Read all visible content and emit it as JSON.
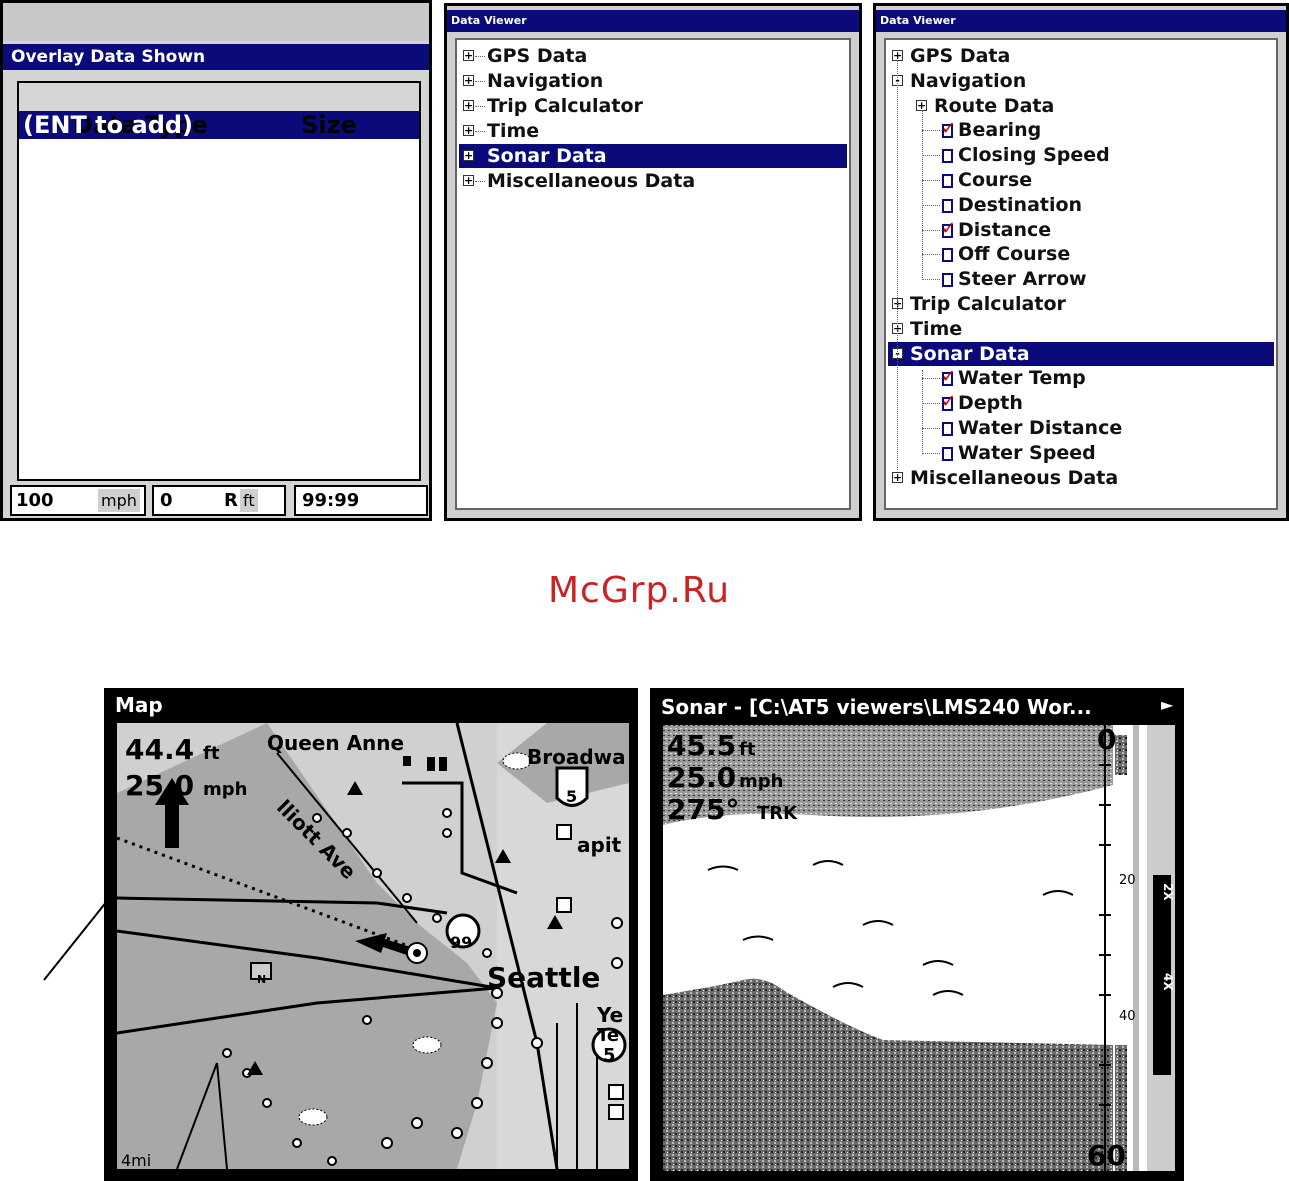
{
  "overlay_panel": {
    "title": "Overlay Data Shown",
    "col_type": "Data Type",
    "col_size": "Size",
    "row": "(ENT to add)",
    "status": {
      "speed": "100",
      "speed_unit": "mph",
      "depth": "0",
      "depth_flag": "R",
      "depth_unit": "ft",
      "time": "99:99"
    }
  },
  "viewer1": {
    "title": "Data Viewer",
    "items": [
      "GPS Data",
      "Navigation",
      "Trip Calculator",
      "Time",
      "Sonar Data",
      "Miscellaneous Data"
    ],
    "selected": "Sonar Data"
  },
  "viewer2": {
    "title": "Data Viewer",
    "items": [
      {
        "label": "GPS Data",
        "level": 0,
        "expander": "+"
      },
      {
        "label": "Navigation",
        "level": 0,
        "expander": "-"
      },
      {
        "label": "Route Data",
        "level": 1,
        "expander": "+"
      },
      {
        "label": "Bearing",
        "level": 2,
        "checked": true
      },
      {
        "label": "Closing Speed",
        "level": 2,
        "checked": false
      },
      {
        "label": "Course",
        "level": 2,
        "checked": false
      },
      {
        "label": "Destination",
        "level": 2,
        "checked": false
      },
      {
        "label": "Distance",
        "level": 2,
        "checked": true
      },
      {
        "label": "Off Course",
        "level": 2,
        "checked": false
      },
      {
        "label": "Steer Arrow",
        "level": 2,
        "checked": false
      },
      {
        "label": "Trip Calculator",
        "level": 0,
        "expander": "+"
      },
      {
        "label": "Time",
        "level": 0,
        "expander": "+"
      },
      {
        "label": "Sonar Data",
        "level": 0,
        "expander": "-",
        "selected": true
      },
      {
        "label": "Water Temp",
        "level": 2,
        "checked": true
      },
      {
        "label": "Depth",
        "level": 2,
        "checked": true
      },
      {
        "label": "Water Distance",
        "level": 2,
        "checked": false
      },
      {
        "label": "Water Speed",
        "level": 2,
        "checked": false
      },
      {
        "label": "Miscellaneous Data",
        "level": 0,
        "expander": "+"
      }
    ]
  },
  "watermark": "McGrp.Ru",
  "map": {
    "title": "Map",
    "depth_value": "44.4",
    "depth_unit": "ft",
    "speed_value": "25.0",
    "speed_unit": "mph",
    "scale": "4mi",
    "labels": {
      "queen_anne": "Queen Anne",
      "broadway": "Broadwa",
      "elliott_ave": "lliott Ave",
      "capitol": "apit",
      "seattle": "Seattle",
      "ye": "Ye",
      "te": "Te",
      "hwy99": "99",
      "hwy5a": "5",
      "hwy5b": "5",
      "n_marker": "N"
    }
  },
  "sonar": {
    "title": "Sonar - [C:\\AT5 viewers\\LMS240 Wor...",
    "depth_value": "45.5",
    "depth_unit": "ft",
    "speed_value": "25.0",
    "speed_unit": "mph",
    "track_value": "275°",
    "track_unit": "TRK",
    "scale_top": "0",
    "scale_mid1": "20",
    "scale_mid2": "40",
    "scale_bottom": "60",
    "zoom1": "2X",
    "zoom2": "4X"
  },
  "colors": {
    "titlebar_blue": "#0a0a7a",
    "check_red": "#cc0000",
    "watermark_red": "#cc2222"
  }
}
